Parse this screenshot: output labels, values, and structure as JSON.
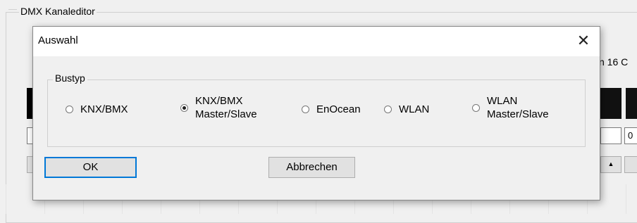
{
  "background": {
    "group_title": "DMX Kanaleditor",
    "right_text": "n 16 C",
    "right_field_value": "0"
  },
  "dialog": {
    "title": "Auswahl",
    "close_symbol": "✕",
    "group_title": "Bustyp",
    "options": [
      {
        "line1": "KNX/BMX",
        "line2": "",
        "checked": false
      },
      {
        "line1": "KNX/BMX",
        "line2": "Master/Slave",
        "checked": true
      },
      {
        "line1": "EnOcean",
        "line2": "",
        "checked": false
      },
      {
        "line1": "WLAN",
        "line2": "",
        "checked": false
      },
      {
        "line1": "WLAN",
        "line2": "Master/Slave",
        "checked": false
      }
    ],
    "ok_label": "OK",
    "cancel_label": "Abbrechen"
  }
}
